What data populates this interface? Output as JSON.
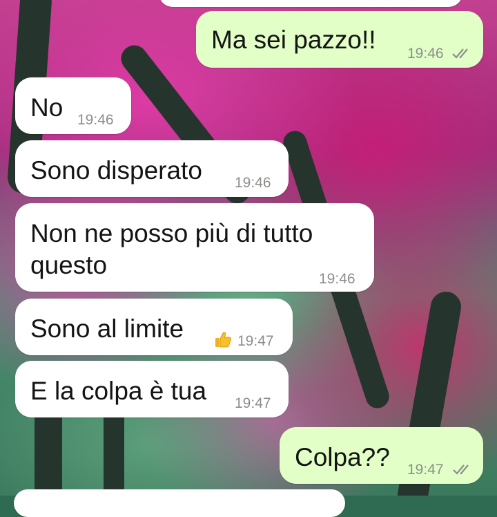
{
  "chat": {
    "messages": [
      {
        "direction": "out",
        "text": "Ma sei pazzo!!",
        "time": "19:46",
        "status": "read"
      },
      {
        "direction": "in",
        "text": "No",
        "time": "19:46"
      },
      {
        "direction": "in",
        "text": "Sono disperato",
        "time": "19:46"
      },
      {
        "direction": "in",
        "text_line1": "Non ne posso più di tutto",
        "text_line2": "questo",
        "time": "19:46"
      },
      {
        "direction": "in",
        "text": "Sono al limite",
        "emoji": "thumbs-up",
        "time": "19:47"
      },
      {
        "direction": "in",
        "text": "E la colpa è tua",
        "time": "19:47"
      },
      {
        "direction": "out",
        "text": "Colpa??",
        "time": "19:47",
        "status": "read"
      }
    ]
  },
  "colors": {
    "incoming_bubble": "#ffffff",
    "outgoing_bubble": "#e2ffc7",
    "read_ticks": "#8a8f8a",
    "wallpaper_pink": "#c2408f",
    "wallpaper_green": "#3c7a5d"
  },
  "icons": {
    "read_receipt": "double-check-icon",
    "emoji": "thumbs-up-icon"
  }
}
